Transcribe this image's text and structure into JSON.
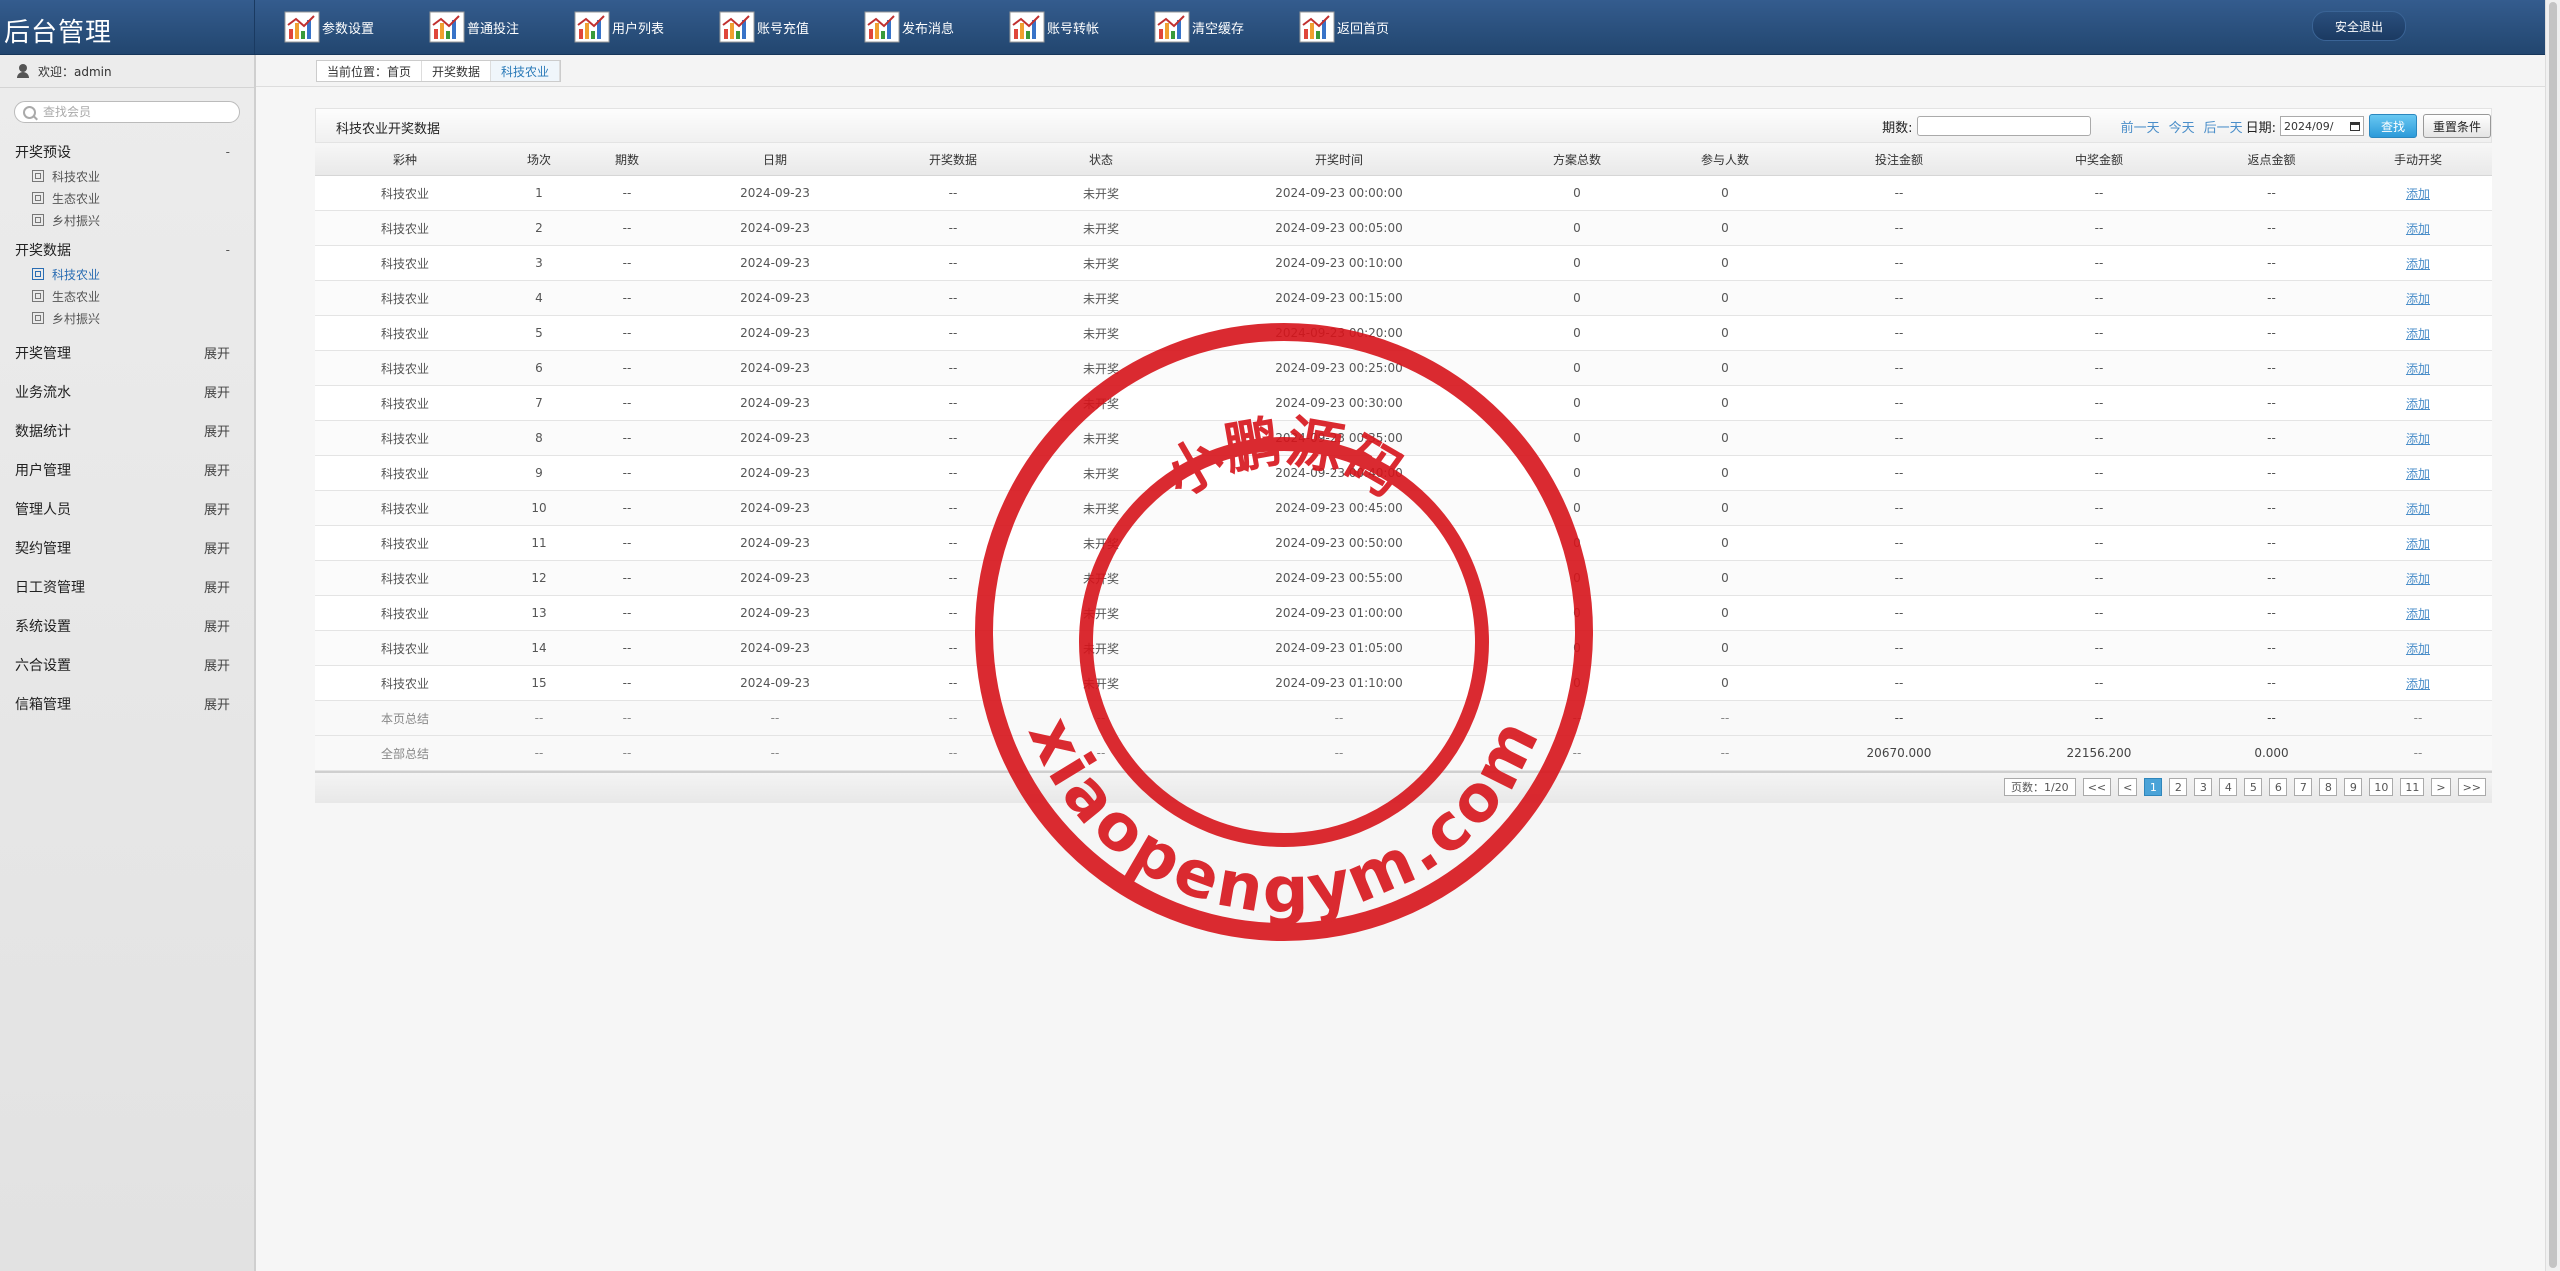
{
  "app": {
    "title": "后台管理"
  },
  "topnav": [
    {
      "label": "参数设置"
    },
    {
      "label": "普通投注"
    },
    {
      "label": "用户列表"
    },
    {
      "label": "账号充值"
    },
    {
      "label": "发布消息"
    },
    {
      "label": "账号转帐"
    },
    {
      "label": "清空缓存"
    },
    {
      "label": "返回首页"
    }
  ],
  "logout_label": "安全退出",
  "sidebar": {
    "welcome": "欢迎：admin",
    "search_placeholder": "查找会员",
    "sections": [
      {
        "title": "开奖预设",
        "toggle": "-",
        "items": [
          "科技农业",
          "生态农业",
          "乡村振兴"
        ]
      },
      {
        "title": "开奖数据",
        "toggle": "-",
        "items": [
          "科技农业",
          "生态农业",
          "乡村振兴"
        ]
      }
    ],
    "menus": [
      {
        "label": "开奖管理",
        "action": "展开"
      },
      {
        "label": "业务流水",
        "action": "展开"
      },
      {
        "label": "数据统计",
        "action": "展开"
      },
      {
        "label": "用户管理",
        "action": "展开"
      },
      {
        "label": "管理人员",
        "action": "展开"
      },
      {
        "label": "契约管理",
        "action": "展开"
      },
      {
        "label": "日工资管理",
        "action": "展开"
      },
      {
        "label": "系统设置",
        "action": "展开"
      },
      {
        "label": "六合设置",
        "action": "展开"
      },
      {
        "label": "信箱管理",
        "action": "展开"
      }
    ]
  },
  "breadcrumb": [
    "当前位置：首页",
    "开奖数据",
    "科技农业"
  ],
  "panel": {
    "title": "科技农业开奖数据",
    "period_label": "期数:",
    "prev_day": "前一天",
    "today": "今天",
    "next_day": "后一天",
    "date_label": "日期:",
    "date_value": "2024/09/",
    "search_btn": "查找",
    "reset_btn": "重置条件"
  },
  "table": {
    "columns": [
      "彩种",
      "场次",
      "期数",
      "日期",
      "开奖数据",
      "状态",
      "开奖时间",
      "方案总数",
      "参与人数",
      "投注金额",
      "中奖金额",
      "返点金额",
      "手动开奖"
    ],
    "rows": [
      [
        "科技农业",
        "1",
        "--",
        "2024-09-23",
        "--",
        "未开奖",
        "2024-09-23 00:00:00",
        "0",
        "0",
        "--",
        "--",
        "--",
        "添加"
      ],
      [
        "科技农业",
        "2",
        "--",
        "2024-09-23",
        "--",
        "未开奖",
        "2024-09-23 00:05:00",
        "0",
        "0",
        "--",
        "--",
        "--",
        "添加"
      ],
      [
        "科技农业",
        "3",
        "--",
        "2024-09-23",
        "--",
        "未开奖",
        "2024-09-23 00:10:00",
        "0",
        "0",
        "--",
        "--",
        "--",
        "添加"
      ],
      [
        "科技农业",
        "4",
        "--",
        "2024-09-23",
        "--",
        "未开奖",
        "2024-09-23 00:15:00",
        "0",
        "0",
        "--",
        "--",
        "--",
        "添加"
      ],
      [
        "科技农业",
        "5",
        "--",
        "2024-09-23",
        "--",
        "未开奖",
        "2024-09-23 00:20:00",
        "0",
        "0",
        "--",
        "--",
        "--",
        "添加"
      ],
      [
        "科技农业",
        "6",
        "--",
        "2024-09-23",
        "--",
        "未开奖",
        "2024-09-23 00:25:00",
        "0",
        "0",
        "--",
        "--",
        "--",
        "添加"
      ],
      [
        "科技农业",
        "7",
        "--",
        "2024-09-23",
        "--",
        "未开奖",
        "2024-09-23 00:30:00",
        "0",
        "0",
        "--",
        "--",
        "--",
        "添加"
      ],
      [
        "科技农业",
        "8",
        "--",
        "2024-09-23",
        "--",
        "未开奖",
        "2024-09-23 00:35:00",
        "0",
        "0",
        "--",
        "--",
        "--",
        "添加"
      ],
      [
        "科技农业",
        "9",
        "--",
        "2024-09-23",
        "--",
        "未开奖",
        "2024-09-23 00:40:00",
        "0",
        "0",
        "--",
        "--",
        "--",
        "添加"
      ],
      [
        "科技农业",
        "10",
        "--",
        "2024-09-23",
        "--",
        "未开奖",
        "2024-09-23 00:45:00",
        "0",
        "0",
        "--",
        "--",
        "--",
        "添加"
      ],
      [
        "科技农业",
        "11",
        "--",
        "2024-09-23",
        "--",
        "未开奖",
        "2024-09-23 00:50:00",
        "0",
        "0",
        "--",
        "--",
        "--",
        "添加"
      ],
      [
        "科技农业",
        "12",
        "--",
        "2024-09-23",
        "--",
        "未开奖",
        "2024-09-23 00:55:00",
        "0",
        "0",
        "--",
        "--",
        "--",
        "添加"
      ],
      [
        "科技农业",
        "13",
        "--",
        "2024-09-23",
        "--",
        "未开奖",
        "2024-09-23 01:00:00",
        "0",
        "0",
        "--",
        "--",
        "--",
        "添加"
      ],
      [
        "科技农业",
        "14",
        "--",
        "2024-09-23",
        "--",
        "未开奖",
        "2024-09-23 01:05:00",
        "0",
        "0",
        "--",
        "--",
        "--",
        "添加"
      ],
      [
        "科技农业",
        "15",
        "--",
        "2024-09-23",
        "--",
        "未开奖",
        "2024-09-23 01:10:00",
        "0",
        "0",
        "--",
        "--",
        "--",
        "添加"
      ]
    ],
    "page_total": [
      "本页总结",
      "--",
      "--",
      "--",
      "--",
      "--",
      "--",
      "--",
      "--",
      "--",
      "--",
      "--",
      "--"
    ],
    "grand_total": [
      "全部总结",
      "--",
      "--",
      "--",
      "--",
      "--",
      "--",
      "--",
      "--",
      "20670.000",
      "22156.200",
      "0.000",
      "--"
    ]
  },
  "pager": {
    "info": "页数：1/20",
    "first": "<<",
    "prev": "<",
    "pages": [
      "1",
      "2",
      "3",
      "4",
      "5",
      "6",
      "7",
      "8",
      "9",
      "10",
      "11"
    ],
    "current": "1",
    "next": ">",
    "last": ">>"
  },
  "watermark": {
    "text_top": "小鹏源码",
    "text_bottom": "xiaopengym.com",
    "color": "#d7141b"
  }
}
